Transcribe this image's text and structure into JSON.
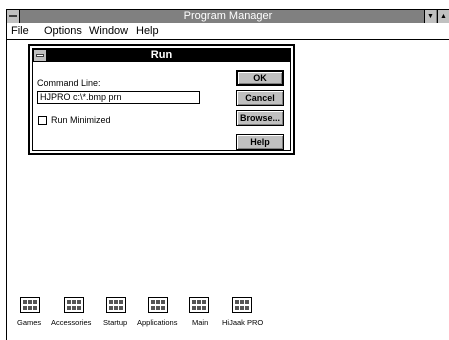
{
  "window": {
    "title": "Program Manager",
    "minimize_glyph": "▼",
    "maximize_glyph": "▲"
  },
  "menu": {
    "items": [
      "File",
      "Options",
      "Window",
      "Help"
    ]
  },
  "dialog": {
    "title": "Run",
    "command_label": "Command Line:",
    "command_value": "HJPRO c:\\*.bmp prn",
    "run_minimized_label": "Run Minimized",
    "run_minimized_checked": false,
    "buttons": {
      "ok": "OK",
      "cancel": "Cancel",
      "browse": "Browse...",
      "help": "Help"
    }
  },
  "groups": [
    "Games",
    "Accessories",
    "Startup",
    "Applications",
    "Main",
    "HiJaak PRO"
  ]
}
